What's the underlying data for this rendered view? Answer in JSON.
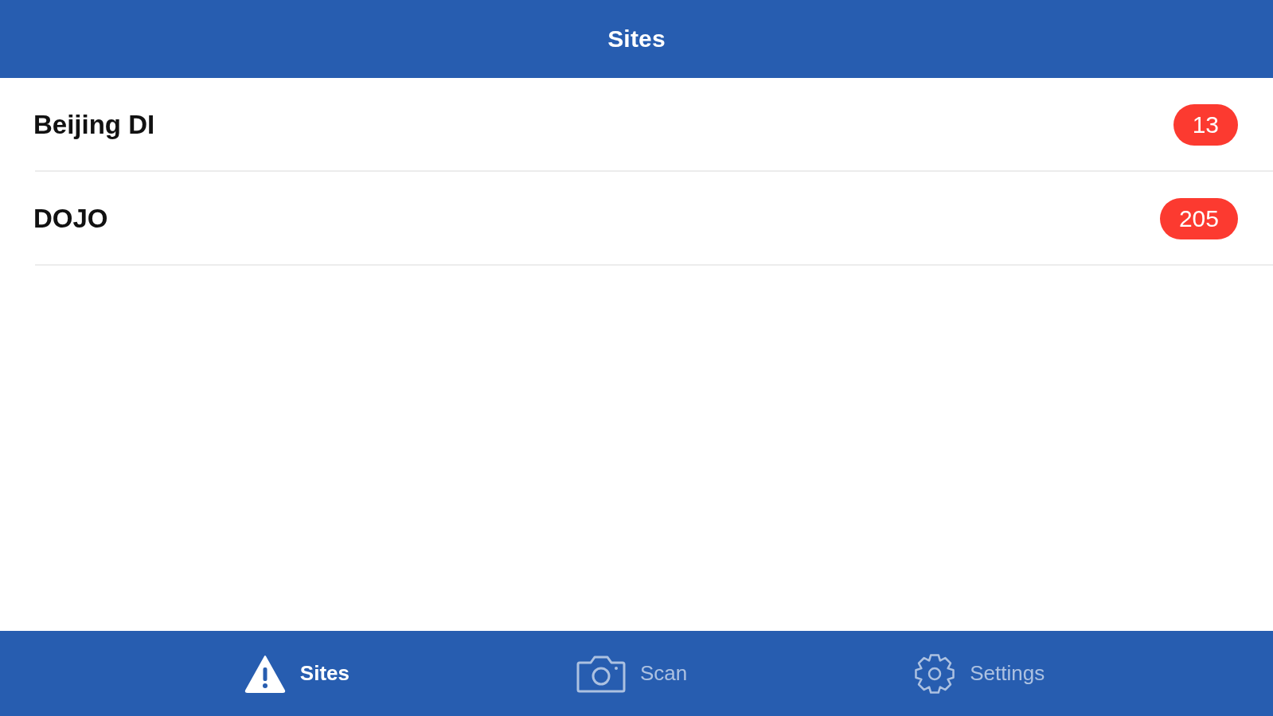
{
  "header": {
    "title": "Sites"
  },
  "sites": [
    {
      "name": "Beijing DI",
      "count": "13"
    },
    {
      "name": "DOJO",
      "count": "205"
    }
  ],
  "tab_bar": [
    {
      "label": "Sites",
      "selected": true
    },
    {
      "label": "Scan",
      "selected": false
    },
    {
      "label": "Settings",
      "selected": false
    }
  ]
}
